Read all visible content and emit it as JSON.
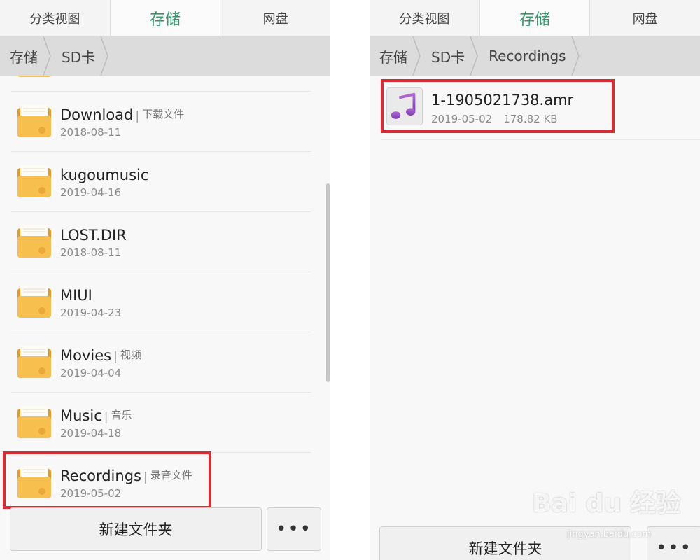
{
  "left": {
    "tabs": [
      {
        "label": "分类视图"
      },
      {
        "label": "存储"
      },
      {
        "label": "网盘"
      }
    ],
    "breadcrumb": [
      "存储",
      "SD卡"
    ],
    "folders": [
      {
        "name": "Download",
        "tag": "下载文件",
        "date": "2018-08-11"
      },
      {
        "name": "kugoumusic",
        "tag": "",
        "date": "2019-04-16"
      },
      {
        "name": "LOST.DIR",
        "tag": "",
        "date": "2018-08-11"
      },
      {
        "name": "MIUI",
        "tag": "",
        "date": "2019-04-23"
      },
      {
        "name": "Movies",
        "tag": "视频",
        "date": "2019-04-04"
      },
      {
        "name": "Music",
        "tag": "音乐",
        "date": "2019-04-18"
      },
      {
        "name": "Recordings",
        "tag": "录音文件",
        "date": "2019-05-02"
      }
    ],
    "new_folder_label": "新建文件夹",
    "more_label": "•••"
  },
  "right": {
    "tabs": [
      {
        "label": "分类视图"
      },
      {
        "label": "存储"
      },
      {
        "label": "网盘"
      }
    ],
    "breadcrumb": [
      "存储",
      "SD卡",
      "Recordings"
    ],
    "file": {
      "name": "1-1905021738.amr",
      "date": "2019-05-02",
      "size": "178.82 KB"
    },
    "new_folder_label": "新建文件夹",
    "more_label": "•••"
  },
  "active_tab_color": "#2e9b6a",
  "highlight_color": "#d92b31",
  "folder_icon": "folder-icon",
  "music_icon": "music-note-icon",
  "watermark": {
    "main": "Bai du 经验",
    "sub": "jingyan.baidu.com"
  }
}
